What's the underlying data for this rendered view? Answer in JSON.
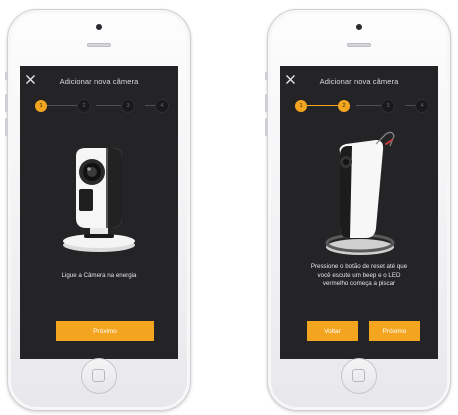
{
  "screens": [
    {
      "title": "Adicionar nova câmera",
      "steps": [
        {
          "label": "1",
          "active": true
        },
        {
          "label": "2",
          "active": false
        },
        {
          "label": "3",
          "active": false
        },
        {
          "label": "4",
          "active": false
        }
      ],
      "message_lines": [
        "Ligue a Câmera na energia"
      ],
      "buttons": {
        "next": "Próximo"
      }
    },
    {
      "title": "Adicionar nova câmera",
      "steps": [
        {
          "label": "1",
          "active": true
        },
        {
          "label": "2",
          "active": true
        },
        {
          "label": "3",
          "active": false
        },
        {
          "label": "4",
          "active": false
        }
      ],
      "message_lines": [
        "Pressione o botão de reset até que",
        "você escute um beep e o LED",
        "vermelho começa a piscar"
      ],
      "buttons": {
        "back": "Voltar",
        "next": "Próximo"
      }
    }
  ],
  "colors": {
    "accent": "#f3a51f",
    "screen_bg": "#242326"
  },
  "icons": {
    "close": "close-icon",
    "device": "camera-icon"
  }
}
